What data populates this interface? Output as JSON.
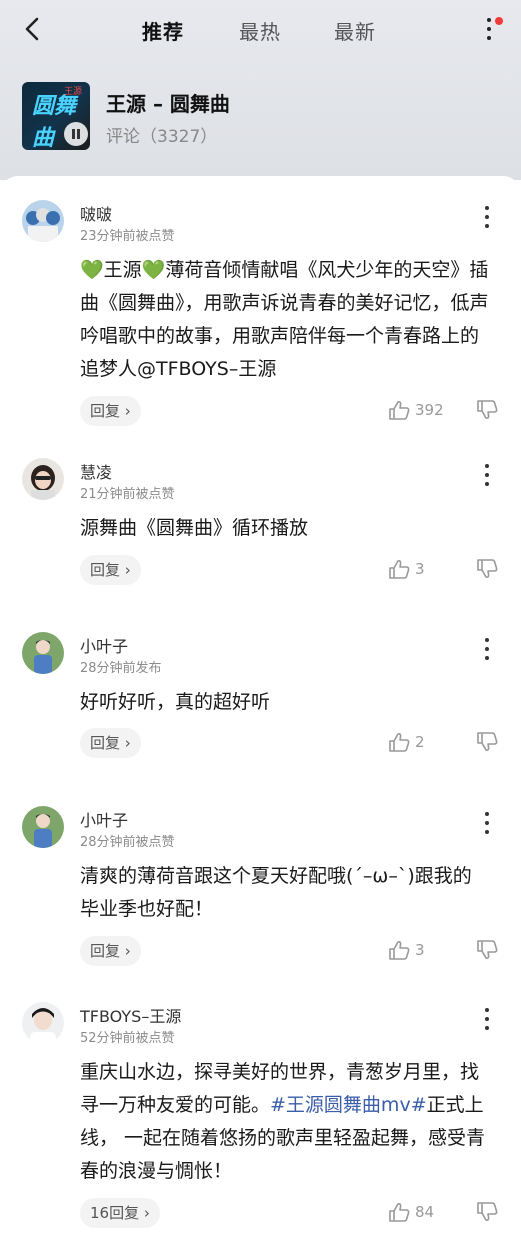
{
  "header": {
    "tabs": [
      {
        "label": "推荐",
        "active": true
      },
      {
        "label": "最热",
        "active": false
      },
      {
        "label": "最新",
        "active": false
      }
    ],
    "has_notification_dot": true
  },
  "song": {
    "title": "王源 – 圆舞曲",
    "comment_count": "评论（3327）",
    "cover_art_text": "圆舞曲",
    "cover_signature": "王源"
  },
  "comments": [
    {
      "username": "啵啵",
      "time": "23分钟前被点赞",
      "text": "💚王源💚薄荷音倾情献唱《风犬少年的天空》插曲《圆舞曲》，用歌声诉说青春的美好记忆，低声吟唱歌中的故事，用歌声陪伴每一个青春路上的追梦人@TFBOYS–王源",
      "reply_label": "回复",
      "likes": "392"
    },
    {
      "username": "慧凌",
      "time": "21分钟前被点赞",
      "text": "源舞曲《圆舞曲》循环播放",
      "reply_label": "回复",
      "likes": "3"
    },
    {
      "username": "小叶子",
      "time": "28分钟前发布",
      "text": "好听好听，真的超好听",
      "reply_label": "回复",
      "likes": "2"
    },
    {
      "username": "小叶子",
      "time": "28分钟前被点赞",
      "text": "清爽的薄荷音跟这个夏天好配哦(´–ω–`)跟我的毕业季也好配！",
      "reply_label": "回复",
      "likes": "3"
    },
    {
      "username": "TFBOYS–王源",
      "time": "52分钟前被点赞",
      "text_before": "重庆山水边，探寻美好的世界，青葱岁月里，找寻一万种友爱的可能。",
      "hashtag": "#王源圆舞曲mv#",
      "text_after": "正式上线， 一起在随着悠扬的歌声里轻盈起舞，感受青春的浪漫与惆怅！",
      "reply_label": "16回复",
      "likes": "84"
    }
  ],
  "colors": {
    "notification_dot": "#f33a3a",
    "hashtag": "#3a5ea8",
    "like_count": "#999999"
  }
}
